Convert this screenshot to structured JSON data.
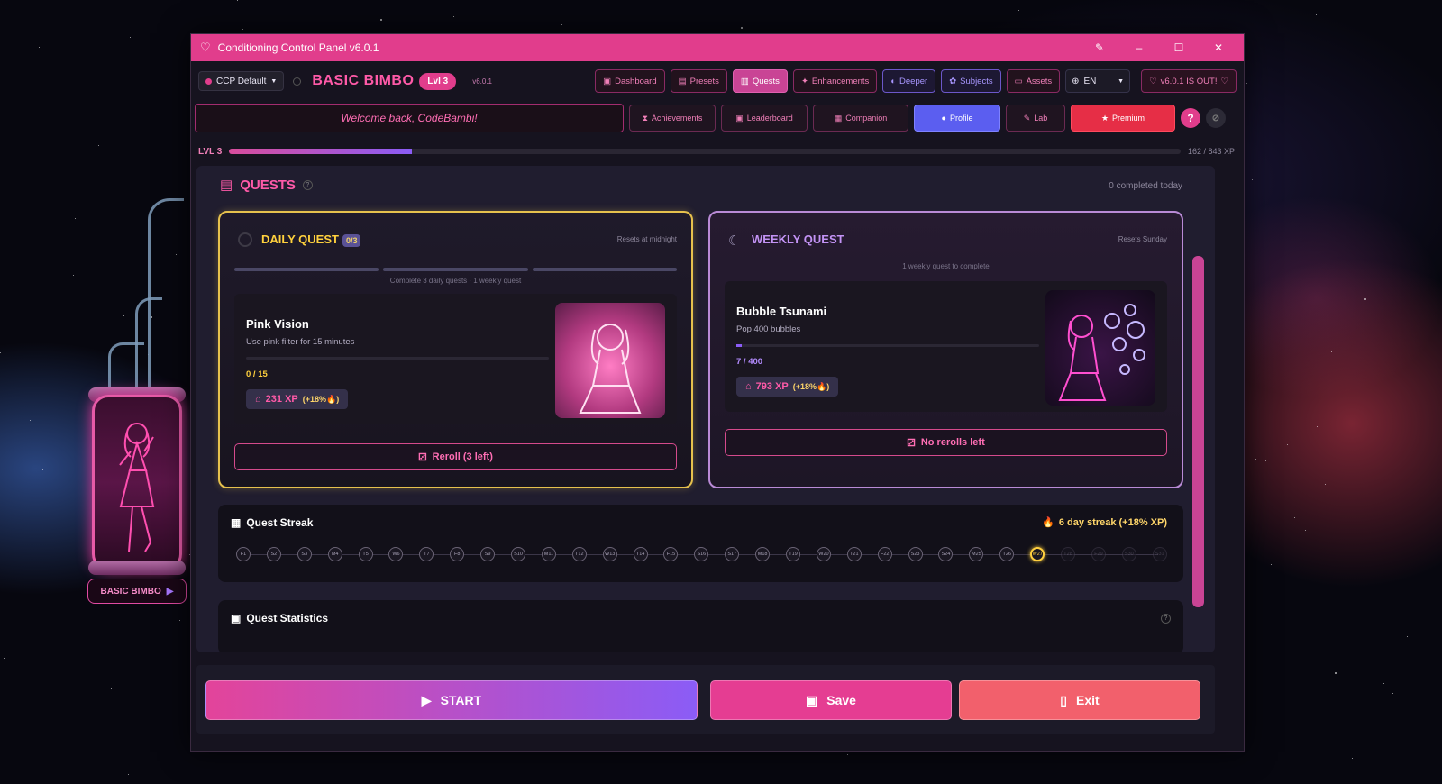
{
  "window": {
    "title": "Conditioning Control Panel v6.0.1"
  },
  "toolbar": {
    "preset": "CCP Default",
    "rank": "BASIC BIMBO",
    "level": "Lvl 3",
    "version": "v6.0.1",
    "nav": [
      "Dashboard",
      "Presets",
      "Quests",
      "Enhancements",
      "Deeper",
      "Subjects",
      "Assets"
    ],
    "language": "EN",
    "update": "v6.0.1 IS OUT!"
  },
  "row2": {
    "welcome": "Welcome back, CodeBambi!",
    "tabs": [
      "Achievements",
      "Leaderboard",
      "Companion",
      "Profile",
      "Lab",
      "Premium"
    ],
    "help": "?"
  },
  "xp": {
    "level": "LVL 3",
    "text": "162 / 843 XP",
    "progress": 0.192
  },
  "quests": {
    "title": "QUESTS",
    "completed_today": "0 completed today",
    "daily": {
      "title": "DAILY QUEST",
      "badge": "0/3",
      "resets": "Resets at midnight",
      "segments_caption": "Complete 3 daily quests · 1 weekly quest",
      "name": "Pink Vision",
      "description": "Use pink filter for 15 minutes",
      "progress_text": "0 / 15",
      "progress": 0,
      "reward": "231 XP",
      "bonus": "(+18%",
      "bonus_end": ")",
      "reroll": "Reroll (3 left)"
    },
    "weekly": {
      "title": "WEEKLY QUEST",
      "resets": "Resets Sunday",
      "caption": "1 weekly quest to complete",
      "name": "Bubble Tsunami",
      "description": "Pop 400 bubbles",
      "progress_text": "7 / 400",
      "progress": 0.0175,
      "reward": "793 XP",
      "bonus": "(+18%",
      "bonus_end": ")",
      "reroll": "No rerolls left"
    },
    "streak": {
      "title": "Quest Streak",
      "info": "6 day streak (+18% XP)",
      "days": [
        "F1",
        "S2",
        "S3",
        "M4",
        "T5",
        "W6",
        "T7",
        "F8",
        "S9",
        "S10",
        "M11",
        "T12",
        "W13",
        "T14",
        "F15",
        "S16",
        "S17",
        "M18",
        "T19",
        "W20",
        "T21",
        "F22",
        "S23",
        "S24",
        "M25",
        "T26",
        "W27",
        "T28",
        "F29",
        "S30",
        "S31"
      ],
      "today_index": 26
    },
    "stats": {
      "title": "Quest Statistics",
      "help": "?"
    }
  },
  "pod": {
    "label": "BASIC BIMBO"
  },
  "actions": {
    "start": "START",
    "save": "Save",
    "exit": "Exit"
  },
  "colors": {
    "accent": "#e13d8c",
    "gold": "#e6c14d",
    "purple": "#8b5cf6",
    "exit": "#f2606c"
  }
}
